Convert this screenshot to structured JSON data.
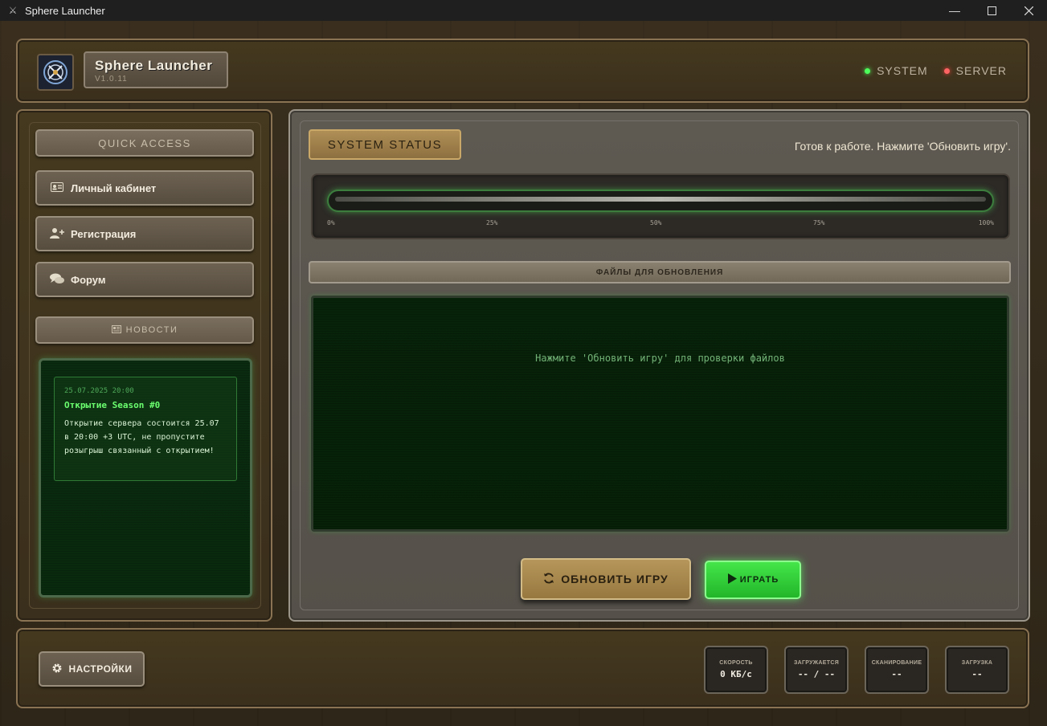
{
  "window": {
    "title": "Sphere Launcher"
  },
  "header": {
    "app_name": "Sphere Launcher",
    "version": "V1.0.11",
    "indicators": [
      {
        "label": "SYSTEM",
        "color": "#4dff5a"
      },
      {
        "label": "SERVER",
        "color": "#ff6464"
      }
    ]
  },
  "sidebar": {
    "quick_access_label": "QUICK ACCESS",
    "items": [
      {
        "label": "Личный кабинет",
        "icon": "id-card-icon"
      },
      {
        "label": "Регистрация",
        "icon": "user-plus-icon"
      },
      {
        "label": "Форум",
        "icon": "chat-bubbles-icon"
      }
    ],
    "news_label": "НОВОСТИ",
    "news": [
      {
        "date": "25.07.2025 20:00",
        "title": "Открытие Season #0",
        "body": "Открытие сервера состоится 25.07 в 20:00 +3 UTC, не пропустите розыгрыш связанный с открытием!"
      }
    ]
  },
  "main": {
    "status_chip": "SYSTEM STATUS",
    "status_text": "Готов к работе. Нажмите 'Обновить игру'.",
    "progress": {
      "percent": 0,
      "ticks": [
        "0%",
        "25%",
        "50%",
        "75%",
        "100%"
      ]
    },
    "files_header": "ФАЙЛЫ ДЛЯ ОБНОВЛЕНИЯ",
    "files_message": "Нажмите 'Обновить игру' для проверки файлов",
    "update_button": "ОБНОВИТЬ ИГРУ",
    "play_button": "ИГРАТЬ"
  },
  "footer": {
    "settings_button": "НАСТРОЙКИ",
    "stats": [
      {
        "label": "СКОРОСТЬ",
        "value": "0 КБ/с"
      },
      {
        "label": "ЗАГРУЖАЕТСЯ",
        "value": "-- / --"
      },
      {
        "label": "СКАНИРОВАНИЕ",
        "value": "--"
      },
      {
        "label": "ЗАГРУЗКА",
        "value": "--"
      }
    ]
  }
}
